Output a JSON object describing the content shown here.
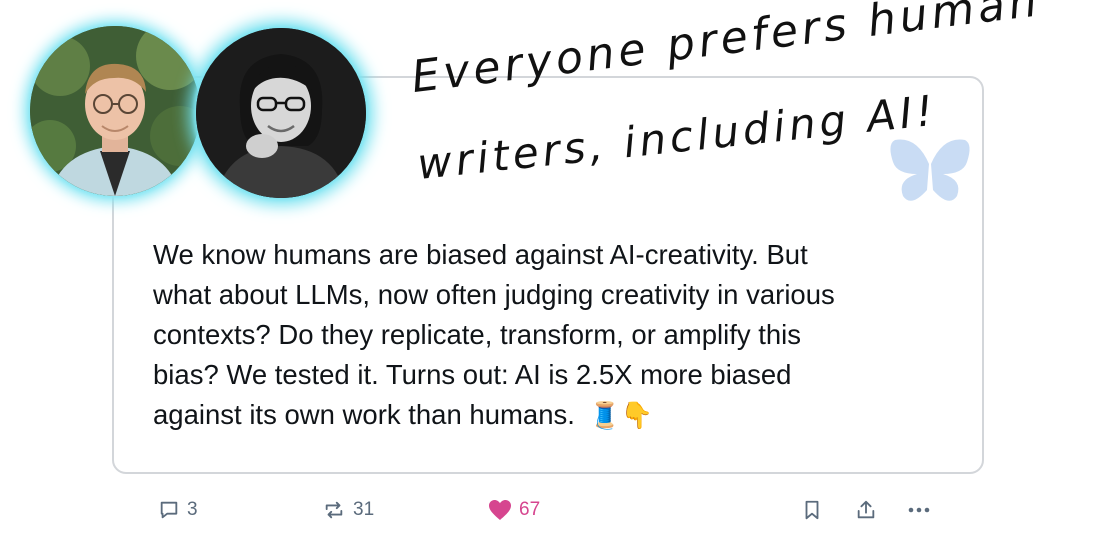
{
  "post": {
    "text": "We know humans are biased against AI-creativity. But\nwhat about LLMs, now often judging creativity in various\ncontexts? Do they replicate, transform, or amplify this\nbias? We tested it. Turns out: AI is 2.5X more biased\nagainst its own work than humans.",
    "emojis": "🧵👇"
  },
  "overlay": {
    "line1": "Everyone prefers human",
    "line2": "writers, including AI!"
  },
  "actions": {
    "replies": "3",
    "reposts": "31",
    "likes": "67"
  },
  "icons": {
    "reply": "speech-bubble-icon",
    "repost": "repost-arrows-icon",
    "like": "heart-icon",
    "bookmark": "bookmark-icon",
    "share": "share-icon",
    "more": "ellipsis-icon",
    "decoration": "butterfly-icon"
  },
  "colors": {
    "avatar_glow": "#6fe0ef",
    "like": "#d6458f",
    "muted": "#5b6b7c",
    "butterfly": "#c9dcf4",
    "card_border": "#d3d6da"
  }
}
